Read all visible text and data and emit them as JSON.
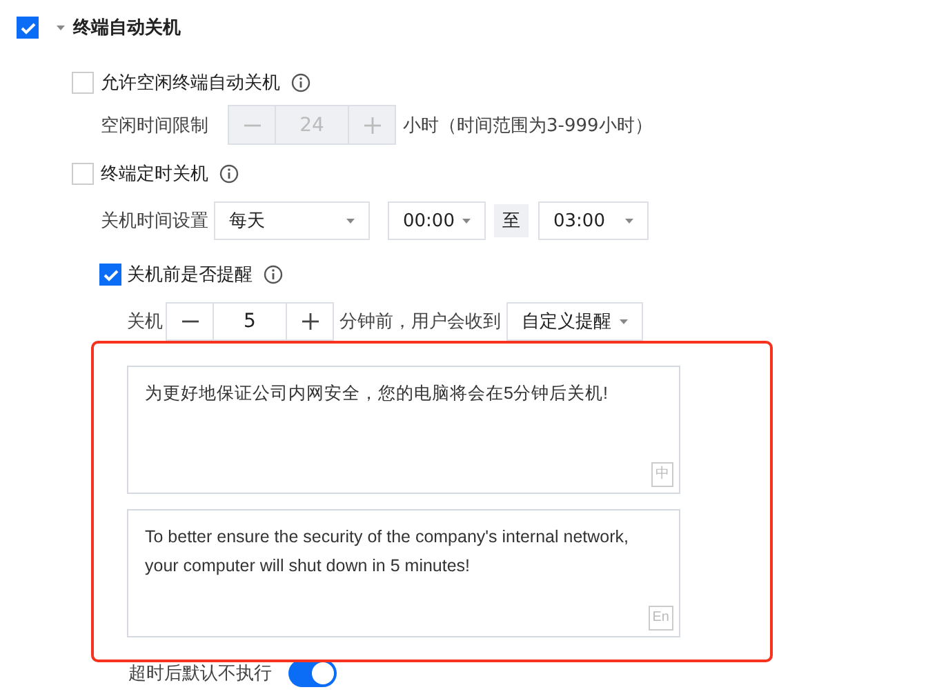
{
  "section": {
    "title": "终端自动关机",
    "checked": true,
    "expanded": true
  },
  "idle_shutdown": {
    "label": "允许空闲终端自动关机",
    "checked": false,
    "limit_label": "空闲时间限制",
    "stepper": {
      "value": "24",
      "disabled": true
    },
    "unit_note": "小时（时间范围为3-999小时）"
  },
  "scheduled_shutdown": {
    "label": "终端定时关机",
    "checked": false,
    "time_label": "关机时间设置",
    "repeat": "每天",
    "start": "00:00",
    "to": "至",
    "end": "03:00"
  },
  "reminder": {
    "label": "关机前是否提醒",
    "checked": true,
    "prefix": "关机",
    "stepper": {
      "value": "5",
      "disabled": false
    },
    "suffix": "分钟前，用户会收到",
    "type": "自定义提醒"
  },
  "messages": [
    {
      "text": "为更好地保证公司内网安全，您的电脑将会在5分钟后关机!",
      "lang": "中"
    },
    {
      "text": "To better ensure the security of the company's internal network, your computer will shut down in 5 minutes!",
      "lang": "En"
    }
  ],
  "timeout": {
    "label": "超时后默认不执行",
    "on": true
  }
}
